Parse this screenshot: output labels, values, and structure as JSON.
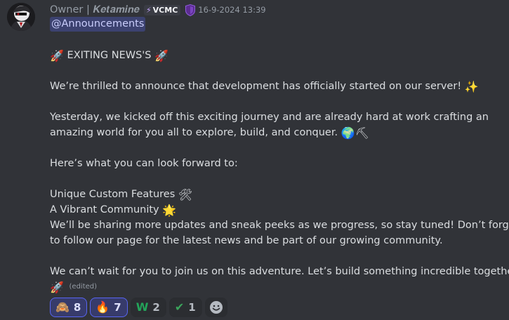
{
  "author": {
    "name": "Owner | 𝑲𝒆𝒕𝒂𝒎𝒊𝒏𝒆",
    "tag_icon": "⚡",
    "tag_label": "VCMC",
    "timestamp": "16-9-2024 13:39",
    "shield_color": "#5c2c91"
  },
  "message": {
    "mention": "@Announcements",
    "lines": [
      {
        "text": "EXITING NEWS'S",
        "emoji_before": "🚀",
        "emoji_after": "🚀"
      },
      {
        "text": "We’re thrilled to announce that development has officially started on our server!",
        "emoji_after": "✨"
      },
      {
        "text": "Yesterday, we kicked off this exciting journey and are already hard at work crafting an"
      },
      {
        "text": "amazing world for you all to explore, build, and conquer.",
        "emoji_after": "🌍⛏"
      },
      {
        "text": "Here’s what you can look forward to:"
      },
      {
        "text": "Unique Custom Features",
        "emoji_after": "🛠"
      },
      {
        "text": "A Vibrant Community",
        "emoji_after": "🌟"
      },
      {
        "text": "We’ll be sharing more updates and sneak peeks as we progress, so stay tuned! Don’t forget"
      },
      {
        "text": "to follow our page for the latest news and be part of our growing community."
      },
      {
        "text": "We can’t wait for you to join us on this adventure. Let’s build something incredible together!"
      },
      {
        "emoji": "🚀",
        "edited": "(edited)"
      }
    ]
  },
  "reactions": [
    {
      "emoji": "🙈",
      "count": "8",
      "selected": true
    },
    {
      "emoji": "🔥",
      "count": "7",
      "selected": true
    },
    {
      "emoji": "W",
      "count": "2",
      "selected": false
    },
    {
      "emoji": "✔",
      "count": "1",
      "selected": false
    }
  ],
  "add_reaction_icon": "smiley-icon"
}
